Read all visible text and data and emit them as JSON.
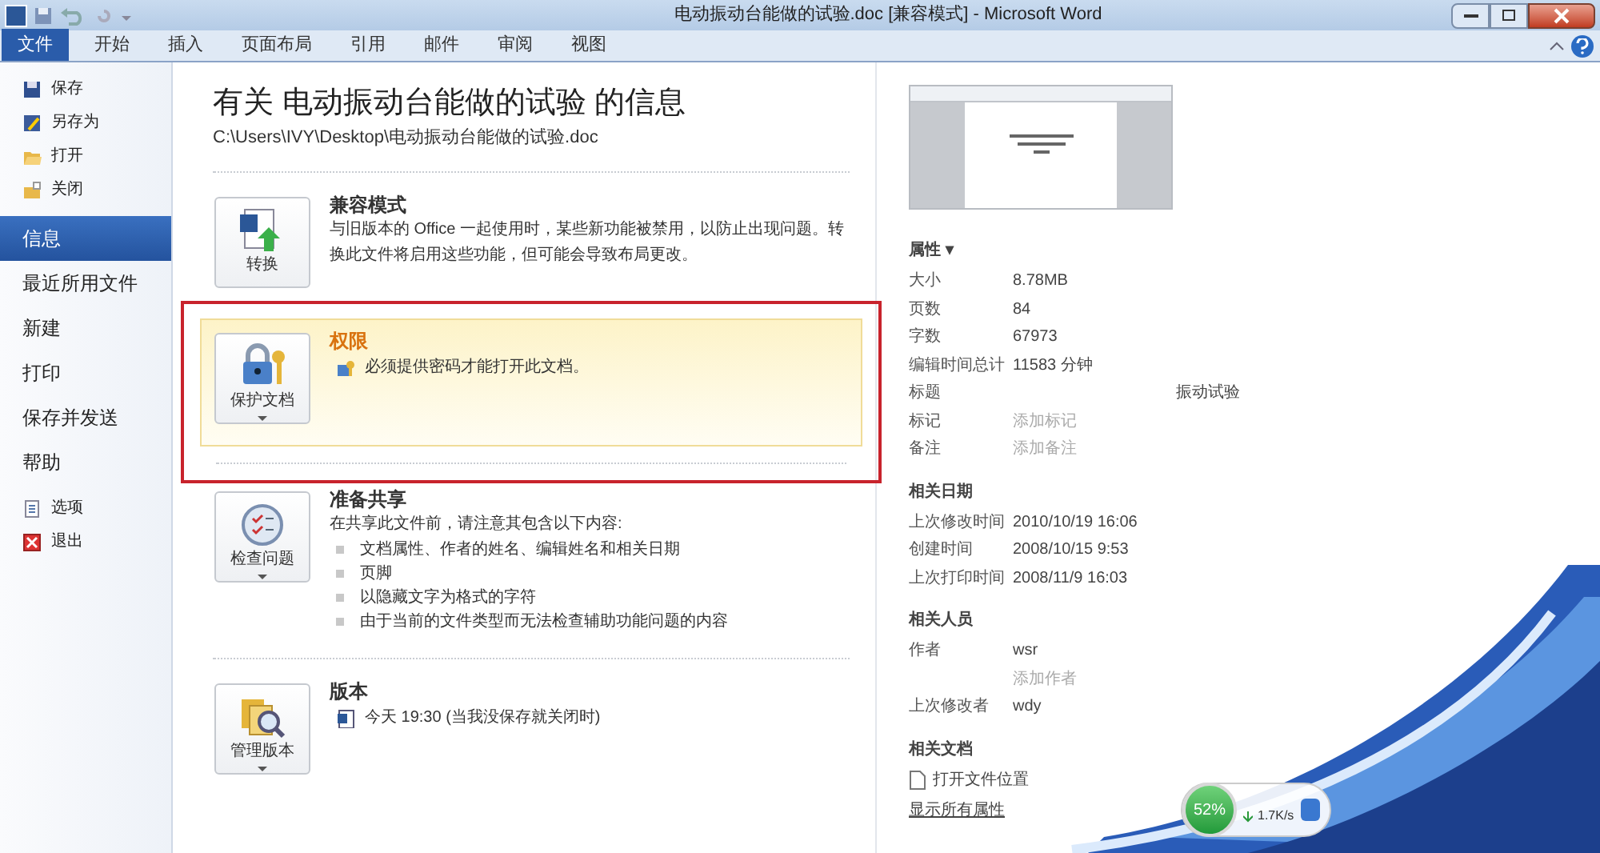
{
  "window": {
    "title": "电动振动台能做的试验.doc [兼容模式] - Microsoft Word"
  },
  "ribbon_tabs": [
    {
      "label": "文件",
      "selected": true
    },
    {
      "label": "开始",
      "selected": false
    },
    {
      "label": "插入",
      "selected": false
    },
    {
      "label": "页面布局",
      "selected": false
    },
    {
      "label": "引用",
      "selected": false
    },
    {
      "label": "邮件",
      "selected": false
    },
    {
      "label": "审阅",
      "selected": false
    },
    {
      "label": "视图",
      "selected": false
    }
  ],
  "backstage_menu": [
    {
      "label": "保存",
      "kind": "command",
      "selected": false
    },
    {
      "label": "另存为",
      "kind": "command",
      "selected": false
    },
    {
      "label": "打开",
      "kind": "command",
      "selected": false
    },
    {
      "label": "关闭",
      "kind": "command",
      "selected": false
    },
    {
      "label": "信息",
      "kind": "page",
      "selected": true
    },
    {
      "label": "最近所用文件",
      "kind": "page",
      "selected": false
    },
    {
      "label": "新建",
      "kind": "page",
      "selected": false
    },
    {
      "label": "打印",
      "kind": "page",
      "selected": false
    },
    {
      "label": "保存并发送",
      "kind": "page",
      "selected": false
    },
    {
      "label": "帮助",
      "kind": "page",
      "selected": false
    },
    {
      "label": "选项",
      "kind": "command",
      "selected": false
    },
    {
      "label": "退出",
      "kind": "command",
      "selected": false
    }
  ],
  "info": {
    "heading": "有关 电动振动台能做的试验 的信息",
    "path": "C:\\Users\\IVY\\Desktop\\电动振动台能做的试验.doc",
    "sections": [
      {
        "button": "转换",
        "dropdown": false,
        "highlighted": false,
        "title": "兼容模式",
        "kind": "text",
        "text": "与旧版本的 Office 一起使用时，某些新功能被禁用，以防止出现问题。转换此文件将启用这些功能，但可能会导致布局更改。"
      },
      {
        "button": "保护文档",
        "dropdown": true,
        "highlighted": true,
        "title": "权限",
        "kind": "note",
        "text": "必须提供密码才能打开此文档。"
      },
      {
        "button": "检查问题",
        "dropdown": true,
        "highlighted": false,
        "title": "准备共享",
        "kind": "list",
        "text": "在共享此文件前，请注意其包含以下内容:",
        "bullets": [
          "文档属性、作者的姓名、编辑姓名和相关日期",
          "页脚",
          "以隐藏文字为格式的字符",
          "由于当前的文件类型而无法检查辅助功能问题的内容"
        ]
      },
      {
        "button": "管理版本",
        "dropdown": true,
        "highlighted": false,
        "title": "版本",
        "kind": "version",
        "text": "今天 19:30 (当我没保存就关闭时)"
      }
    ]
  },
  "properties": {
    "header": "属性 ▾",
    "rows": [
      {
        "label": "大小",
        "value": "8.78MB",
        "kind": "plain"
      },
      {
        "label": "页数",
        "value": "84",
        "kind": "plain"
      },
      {
        "label": "字数",
        "value": "67973",
        "kind": "plain"
      },
      {
        "label": "编辑时间总计",
        "value": "11583 分钟",
        "kind": "plain"
      },
      {
        "label": "标题",
        "value": "振动试验",
        "kind": "field"
      },
      {
        "label": "标记",
        "value": "添加标记",
        "kind": "hint"
      },
      {
        "label": "备注",
        "value": "添加备注",
        "kind": "hint"
      }
    ]
  },
  "related_dates": {
    "header": "相关日期",
    "rows": [
      {
        "label": "上次修改时间",
        "value": "2010/10/19 16:06",
        "kind": "plain"
      },
      {
        "label": "创建时间",
        "value": "2008/10/15 9:53",
        "kind": "plain"
      },
      {
        "label": "上次打印时间",
        "value": "2008/11/9 16:03",
        "kind": "plain"
      }
    ]
  },
  "related_people": {
    "header": "相关人员",
    "rows": [
      {
        "label": "作者",
        "value": "wsr",
        "kind": "plain"
      },
      {
        "value": "添加作者",
        "kind": "hint"
      },
      {
        "label": "上次修改者",
        "value": "wdy",
        "kind": "plain"
      }
    ]
  },
  "related_documents": {
    "header": "相关文档",
    "open_location": "打开文件位置",
    "show_all": "显示所有属性"
  },
  "network_widget": {
    "percent": "52%",
    "download": "1.7K/s"
  }
}
